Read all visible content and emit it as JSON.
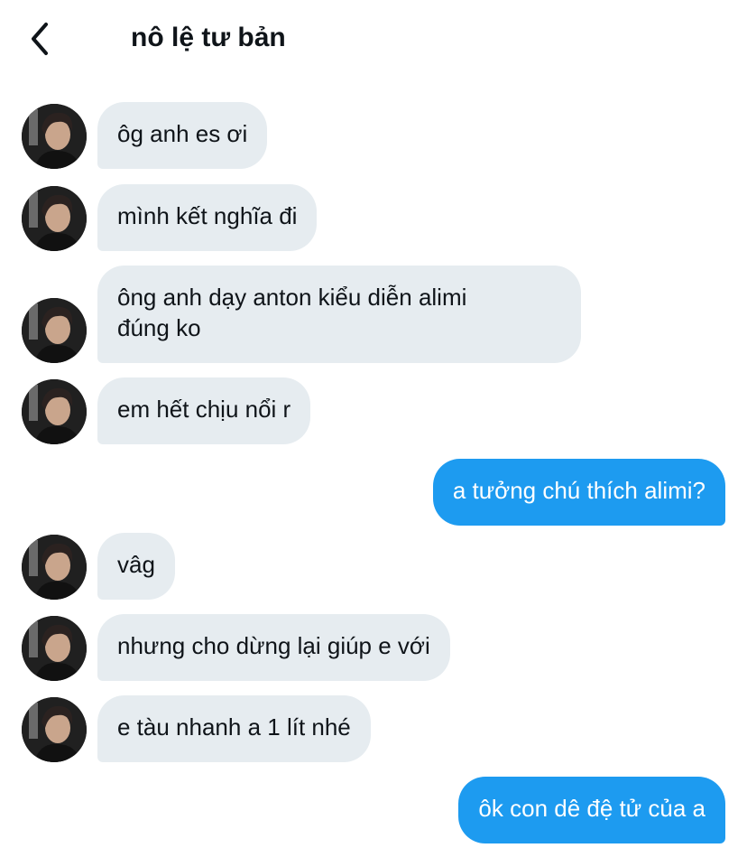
{
  "header": {
    "back_icon": "chevron-left-icon",
    "title": "nô lệ tư bản"
  },
  "messages": [
    {
      "side": "in",
      "text": "ôg anh es ơi"
    },
    {
      "side": "in",
      "text": "mình kết nghĩa đi"
    },
    {
      "side": "in",
      "text": "ông anh dạy anton kiểu diễn alimi\nđúng ko"
    },
    {
      "side": "in",
      "text": "em hết chịu nổi r"
    },
    {
      "side": "out",
      "text": "a tưởng chú thích alimi?"
    },
    {
      "side": "in",
      "text": "vâg"
    },
    {
      "side": "in",
      "text": "nhưng cho dừng lại giúp e với"
    },
    {
      "side": "in",
      "text": "e tàu nhanh a 1 lít nhé"
    },
    {
      "side": "out",
      "text": "ôk con dê đệ tử của a"
    }
  ],
  "colors": {
    "incoming_bubble": "#e6ecf0",
    "outgoing_bubble": "#1d9bf0",
    "text": "#0f1419"
  }
}
